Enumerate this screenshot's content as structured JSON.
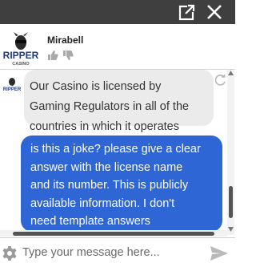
{
  "window": {
    "popout_icon": "popout-icon",
    "close_icon": "close-icon",
    "bar_color": "#3f3f3f"
  },
  "header": {
    "logo_text": "RIPPER",
    "logo_subtext": "CASINO",
    "agent_name": "Mirabell",
    "thumbs_up_icon": "thumbs-up-icon",
    "thumbs_down_icon": "thumbs-down-icon"
  },
  "messages": [
    {
      "sender": "agent",
      "lines": [
        "Our Casino is licensed by",
        "Gaming Regulators in all of the",
        "countries in which it operates"
      ]
    },
    {
      "sender": "user",
      "lines": [
        "is this a joke? please give a clear",
        "answer with the license name",
        "and its number. This is publicly",
        "available information. I don't",
        "need template answers"
      ]
    }
  ],
  "composer": {
    "placeholder": "Type your message here...",
    "value": "",
    "settings_icon": "gear-icon",
    "send_icon": "send-icon"
  },
  "colors": {
    "user_bubble": "#2f66d5",
    "agent_bubble": "#ebebeb"
  }
}
